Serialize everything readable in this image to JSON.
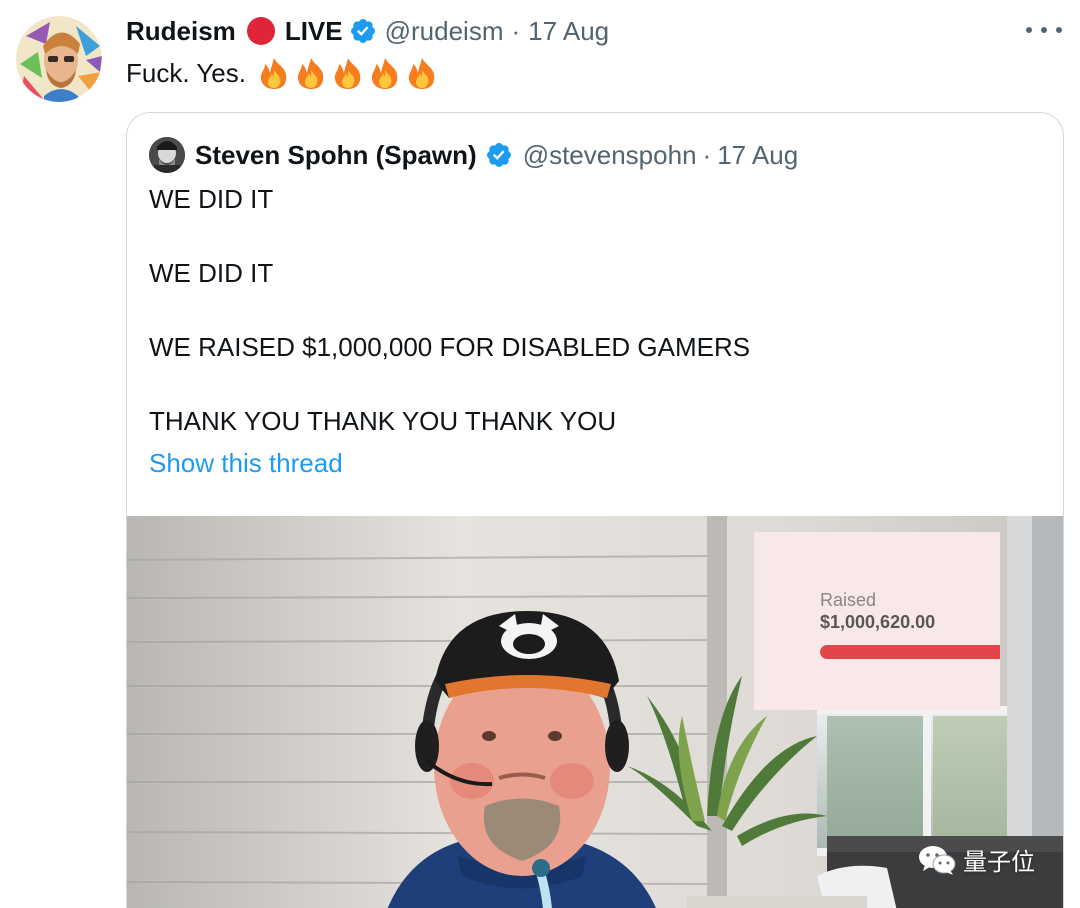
{
  "tweet": {
    "display_name": "Rudeism",
    "live_label": "LIVE",
    "handle": "@rudeism",
    "separator": "·",
    "timestamp": "17 Aug",
    "text": "Fuck. Yes.",
    "emojis": [
      "fire-emoji",
      "fire-emoji",
      "fire-emoji",
      "fire-emoji",
      "fire-emoji"
    ]
  },
  "quote": {
    "display_name": "Steven Spohn (Spawn)",
    "handle": "@stevenspohn",
    "separator": "·",
    "timestamp": "17 Aug",
    "lines": [
      "WE DID IT",
      "WE DID IT",
      "WE RAISED $1,000,000 FOR DISABLED GAMERS",
      "THANK YOU THANK YOU THANK YOU"
    ],
    "show_thread": "Show this thread",
    "media": {
      "raised_label": "Raised",
      "raised_amount": "$1,000,620.00",
      "progress_percent": 100
    }
  },
  "watermark": {
    "text": "量子位"
  },
  "colors": {
    "live_dot": "#e0243a",
    "verified": "#1d9bf0",
    "link": "#1d9bf0",
    "secondary_text": "#536471",
    "progress_fill": "#e2464a",
    "border": "#cfd9de"
  },
  "icons": {
    "verified": "verified-badge-icon",
    "more": "more-options-icon",
    "fire": "fire-emoji",
    "watermark": "wechat-icon"
  }
}
